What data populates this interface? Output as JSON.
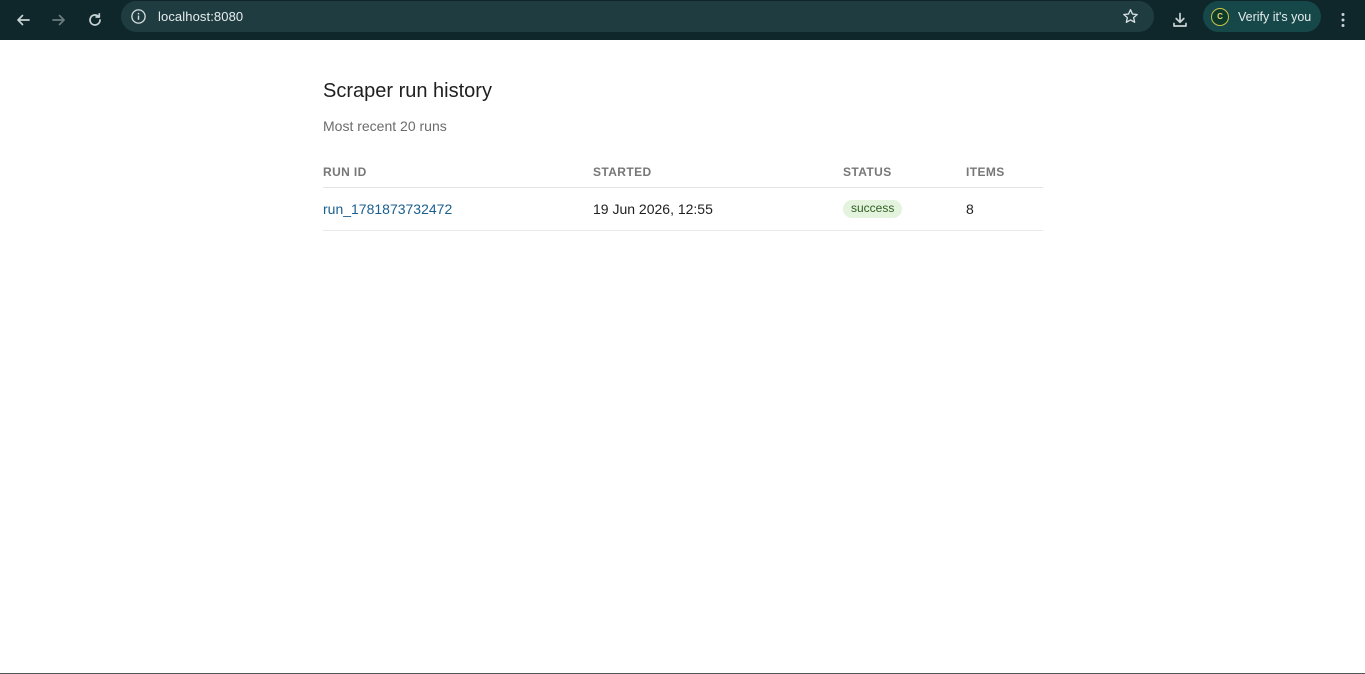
{
  "browser": {
    "url": "localhost:8080",
    "profile_label": "Verify it's you",
    "profile_initial": "C",
    "icons": {
      "back": "back-arrow-icon",
      "forward": "forward-arrow-icon",
      "reload": "reload-icon",
      "site_info": "info-icon",
      "bookmark": "star-icon",
      "download": "download-icon",
      "menu": "kebab-menu-icon"
    },
    "colors": {
      "toolbar": "#0f272b",
      "omnibox": "#1f3d41",
      "profile_chip": "#164849"
    }
  },
  "page": {
    "title": "Scraper run history",
    "subtitle": "Most recent 20 runs"
  },
  "table": {
    "headers": {
      "run_id": "RUN ID",
      "started": "STARTED",
      "status": "STATUS",
      "items": "ITEMS"
    },
    "rows": [
      {
        "run_id": "run_1781873732472",
        "started": "19 Jun 2026, 12:55",
        "status": "success",
        "items": "8"
      }
    ]
  },
  "colors": {
    "link": "#1a5f8f",
    "success_bg": "#e4f3dd",
    "success_text": "#2f5e22"
  }
}
